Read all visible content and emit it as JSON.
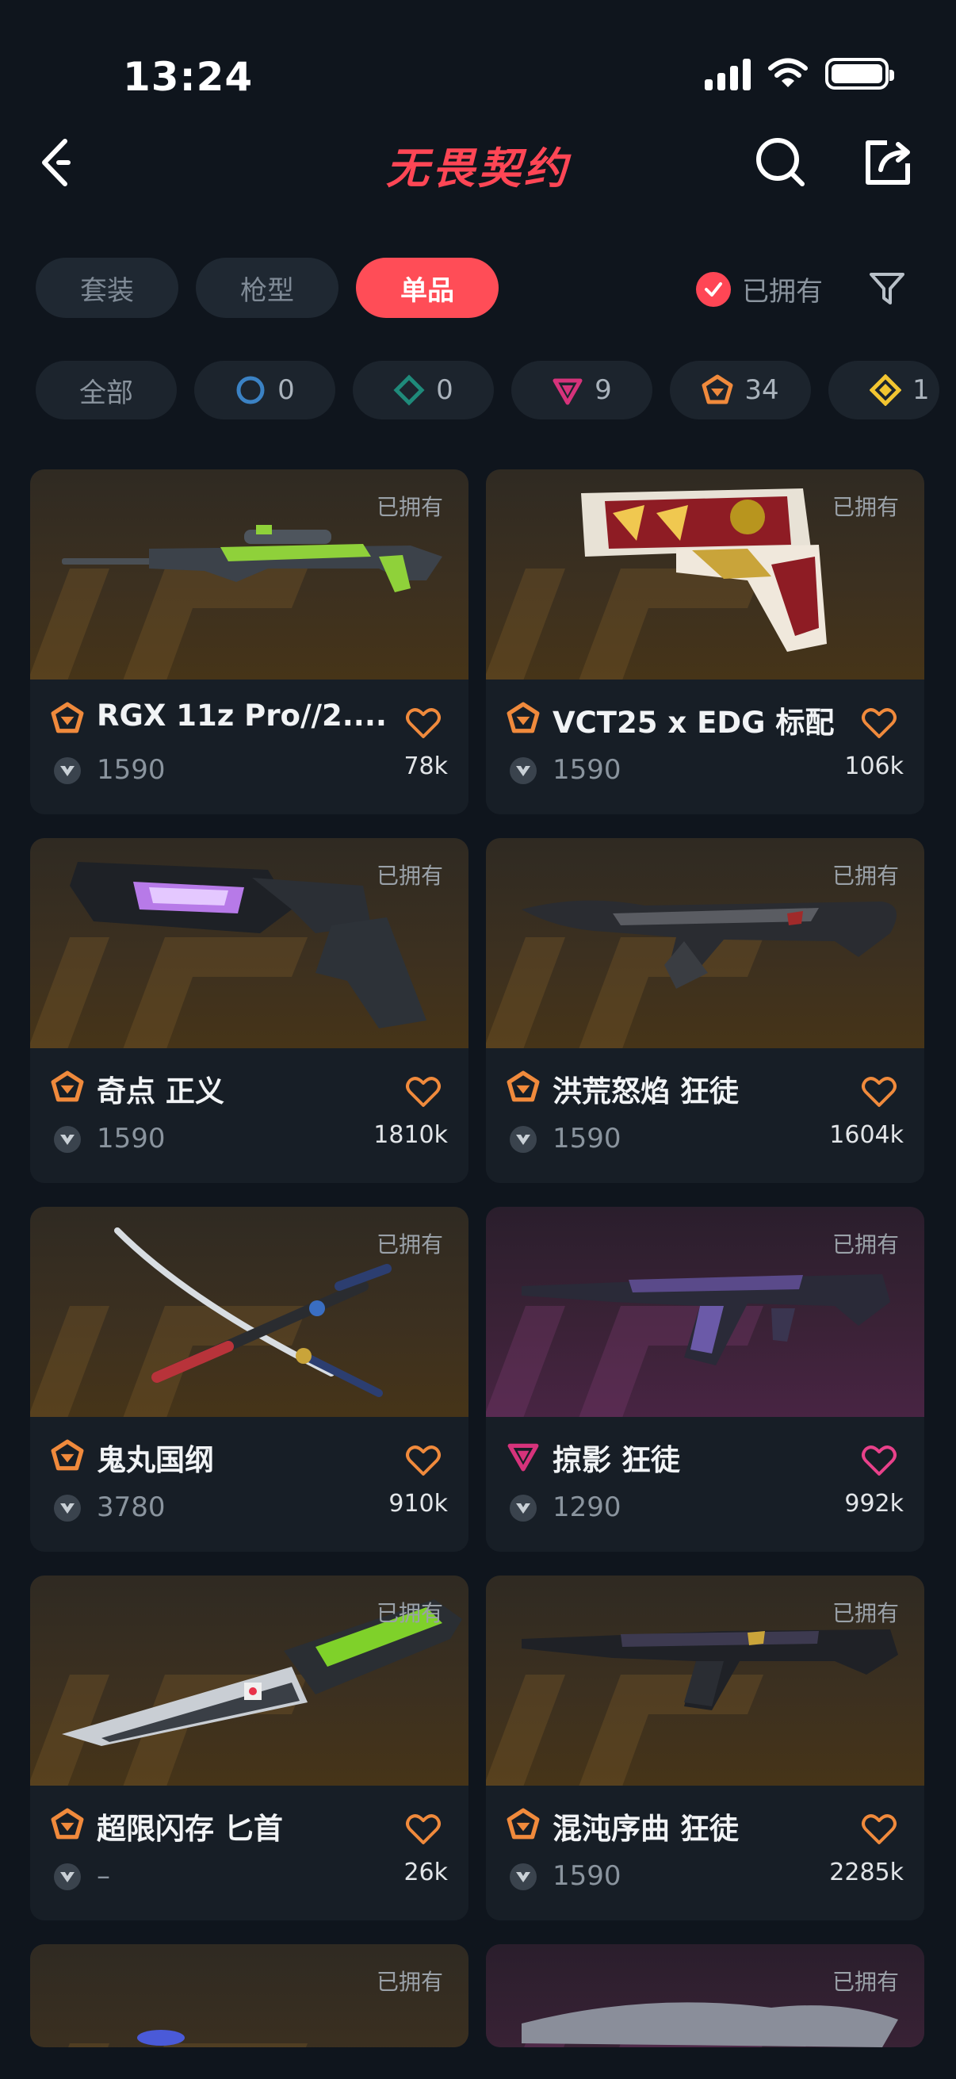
{
  "status_bar": {
    "time": "13:24"
  },
  "nav": {
    "title": "无畏契约",
    "back_icon": "chevron-left-icon",
    "search_icon": "search-icon",
    "share_icon": "share-icon"
  },
  "tabs": [
    {
      "label": "套装",
      "active": false
    },
    {
      "label": "枪型",
      "active": false
    },
    {
      "label": "单品",
      "active": true
    }
  ],
  "owned_filter": {
    "label": "已拥有",
    "checked": true
  },
  "tiers": [
    {
      "label": "全部",
      "count": ""
    },
    {
      "label": "",
      "count": "0",
      "icon": "select-tier-icon",
      "color": "#3b82c4"
    },
    {
      "label": "",
      "count": "0",
      "icon": "deluxe-tier-icon",
      "color": "#1f8a7a"
    },
    {
      "label": "",
      "count": "9",
      "icon": "premium-tier-icon",
      "color": "#d6337b"
    },
    {
      "label": "",
      "count": "34",
      "icon": "exclusive-tier-icon",
      "color": "#f08a3c"
    },
    {
      "label": "",
      "count": "1",
      "icon": "ultra-tier-icon",
      "color": "#f2c531"
    }
  ],
  "items": [
    {
      "name": "RGX 11z Pro//2....",
      "price": "1590",
      "likes": "78k",
      "owned": "已拥有",
      "tier": "exclusive",
      "bg": "brown"
    },
    {
      "name": "VCT25 x EDG 标配",
      "price": "1590",
      "likes": "106k",
      "owned": "已拥有",
      "tier": "exclusive",
      "bg": "brown"
    },
    {
      "name": "奇点 正义",
      "price": "1590",
      "likes": "1810k",
      "owned": "已拥有",
      "tier": "exclusive",
      "bg": "brown"
    },
    {
      "name": "洪荒怒焰 狂徒",
      "price": "1590",
      "likes": "1604k",
      "owned": "已拥有",
      "tier": "exclusive",
      "bg": "brown"
    },
    {
      "name": "鬼丸国纲",
      "price": "3780",
      "likes": "910k",
      "owned": "已拥有",
      "tier": "exclusive",
      "bg": "brown"
    },
    {
      "name": "掠影 狂徒",
      "price": "1290",
      "likes": "992k",
      "owned": "已拥有",
      "tier": "premium",
      "bg": "purple"
    },
    {
      "name": "超限闪存 匕首",
      "price": "–",
      "likes": "26k",
      "owned": "已拥有",
      "tier": "exclusive",
      "bg": "brown"
    },
    {
      "name": "混沌序曲 狂徒",
      "price": "1590",
      "likes": "2285k",
      "owned": "已拥有",
      "tier": "exclusive",
      "bg": "brown"
    },
    {
      "owned": "已拥有",
      "bg": "brown"
    },
    {
      "owned": "已拥有",
      "bg": "purple"
    }
  ]
}
